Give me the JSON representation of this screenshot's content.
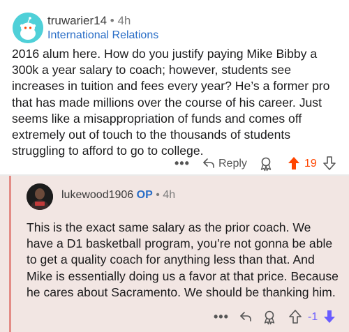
{
  "comment": {
    "username": "truwarier14",
    "separator": "•",
    "time": "4h",
    "flair": "International Relations",
    "body": "2016 alum here. How do you justify paying Mike Bibby a 300k a year salary to coach; however, students see increases in tuition and fees every year? He’s a former pro that has made millions over the course of his career. Just seems like a misappropriation of funds and comes off extremely out of touch to the thousands of students struggling to afford to go to college.",
    "more_label": "•••",
    "reply_label": "Reply",
    "score": "19",
    "vote_color": "#ff4500"
  },
  "reply": {
    "username": "lukewood1906",
    "op_badge": "OP",
    "separator": "•",
    "time": "4h",
    "body": "This is the exact same salary as the prior coach. We have a D1 basketball program, you’re not gonna be able to get a quality coach for anything less than that. And Mike is essentially doing us a favor at that price. Because he cares about Sacramento. We should be thanking him.",
    "more_label": "•••",
    "score": "-1",
    "vote_color": "#6a5cff",
    "thread_line_color": "#e38c86"
  }
}
